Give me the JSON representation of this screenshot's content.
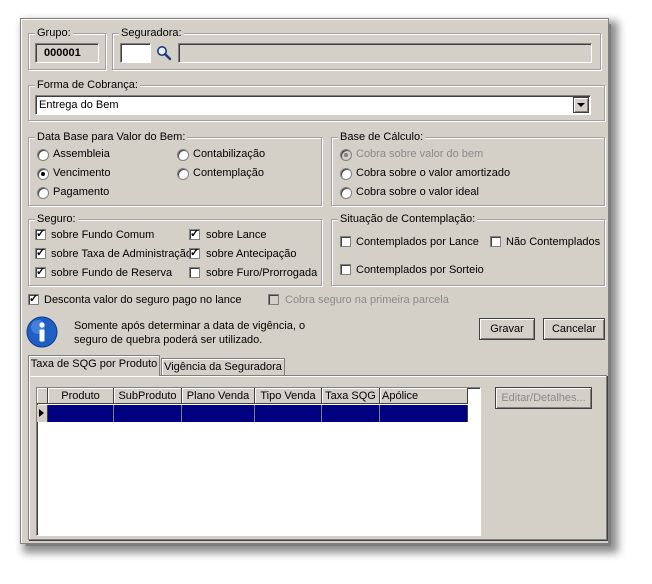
{
  "grupo": {
    "title": "Grupo:",
    "value": "000001"
  },
  "seguradora": {
    "title": "Seguradora:",
    "code": "",
    "name": ""
  },
  "forma_cobranca": {
    "title": "Forma de Cobrança:",
    "selected": "Entrega do Bem"
  },
  "data_base": {
    "title": "Data Base para Valor do Bem:",
    "options": [
      "Assembleia",
      "Contabilização",
      "Vencimento",
      "Contemplação",
      "Pagamento"
    ],
    "selected": "Vencimento"
  },
  "base_calculo": {
    "title": "Base de Cálculo:",
    "options": [
      "Cobra sobre valor do bem",
      "Cobra sobre o valor amortizado",
      "Cobra sobre o valor ideal"
    ],
    "selected": "Cobra sobre valor do bem"
  },
  "seguro": {
    "title": "Seguro:",
    "items": [
      {
        "label": "sobre Fundo Comum",
        "checked": true
      },
      {
        "label": "sobre Lance",
        "checked": true
      },
      {
        "label": "sobre Taxa de Administração",
        "checked": true
      },
      {
        "label": "sobre Antecipação",
        "checked": true
      },
      {
        "label": "sobre Fundo de Reserva",
        "checked": true
      },
      {
        "label": "sobre Furo/Prorrogada",
        "checked": false
      }
    ]
  },
  "situacao": {
    "title": "Situação de Contemplação:",
    "items": [
      {
        "label": "Contemplados por Lance",
        "checked": false
      },
      {
        "label": "Não Contemplados",
        "checked": false
      },
      {
        "label": "Contemplados por Sorteio",
        "checked": false
      }
    ]
  },
  "desconta": {
    "label": "Desconta valor do seguro pago no lance",
    "checked": true
  },
  "cobra_primeira": {
    "label": "Cobra seguro na primeira parcela",
    "checked": false
  },
  "info": {
    "line1": "Somente após determinar a data de vigência, o",
    "line2": "seguro de quebra poderá ser utilizado."
  },
  "buttons": {
    "gravar": "Gravar",
    "cancelar": "Cancelar",
    "editar": "Editar/Detalhes..."
  },
  "tabs": [
    "Taxa de SQG por Produto",
    "Vigência da Seguradora"
  ],
  "grid": {
    "columns": [
      "Produto",
      "SubProduto",
      "Plano Venda",
      "Tipo Venda",
      "Taxa SQG",
      "Apólice"
    ]
  },
  "colors": {
    "face": "#d4d0c8",
    "selection": "#000080",
    "info_blue": "#1f5fc4"
  }
}
